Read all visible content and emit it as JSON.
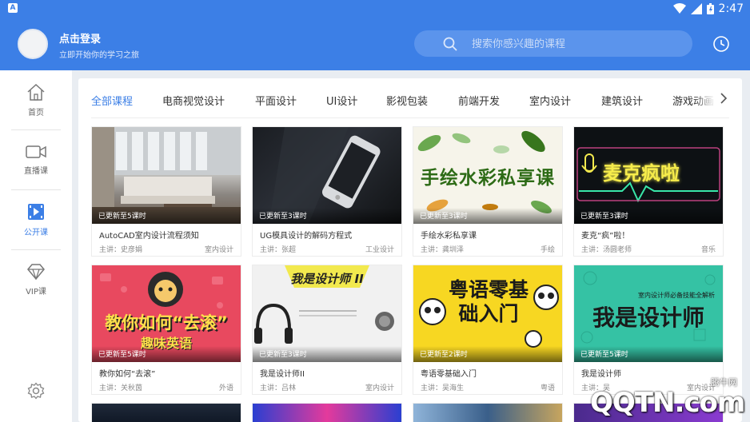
{
  "status_bar": {
    "time": "2:47",
    "app_badge": "A"
  },
  "header": {
    "login_title": "点击登录",
    "login_subtitle": "立即开始你的学习之旅",
    "search_placeholder": "搜索你感兴趣的课程"
  },
  "sidebar": {
    "items": [
      {
        "label": "首页",
        "icon": "home-icon",
        "active": false
      },
      {
        "label": "直播课",
        "icon": "video-camera-icon",
        "active": false
      },
      {
        "label": "公开课",
        "icon": "play-icon",
        "active": true
      },
      {
        "label": "VIP课",
        "icon": "diamond-icon",
        "active": false
      }
    ]
  },
  "tabs": [
    "全部课程",
    "电商视觉设计",
    "平面设计",
    "UI设计",
    "影视包装",
    "前端开发",
    "室内设计",
    "建筑设计",
    "游戏动画"
  ],
  "active_tab": "全部课程",
  "courses": [
    {
      "update": "已更新至5课时",
      "title": "AutoCAD室内设计流程须知",
      "teacher": "主讲：史彦娟",
      "category": "室内设计"
    },
    {
      "update": "已更新至3课时",
      "title": "UG模具设计的解码方程式",
      "teacher": "主讲：张超",
      "category": "工业设计"
    },
    {
      "update": "已更新至3课时",
      "title": "手绘水彩私享课",
      "teacher": "主讲：龚圳泽",
      "category": "手绘",
      "thumb_text": "手绘水彩私享课"
    },
    {
      "update": "已更新至3课时",
      "title": "麦克“疯”啦！",
      "teacher": "主讲：汤圆老师",
      "category": "音乐",
      "thumb_text": "麦克疯啦"
    },
    {
      "update": "已更新至5课时",
      "title": "教你如何“去滚”",
      "teacher": "主讲：关秋茵",
      "category": "外语",
      "thumb_text": "教你如何“去滚”",
      "thumb_sub": "趣味英语"
    },
    {
      "update": "已更新至3课时",
      "title": "我是设计师II",
      "teacher": "主讲：吕林",
      "category": "室内设计",
      "thumb_text": "我是设计师 II"
    },
    {
      "update": "已更新至2课时",
      "title": "粤语零基础入门",
      "teacher": "主讲：吴海生",
      "category": "粤语",
      "thumb_text": "粤语零基础入门"
    },
    {
      "update": "已更新至5课时",
      "title": "我是设计师",
      "teacher": "主讲：吴",
      "category": "室内设计",
      "thumb_text": "我是设计师",
      "thumb_sub": "室内设计师必备技能全解析"
    }
  ],
  "watermark": {
    "logo": "QQTN.com",
    "cn": "腾牛网"
  },
  "colors": {
    "accent": "#3c7fe6",
    "header": "#3c7fe6"
  }
}
